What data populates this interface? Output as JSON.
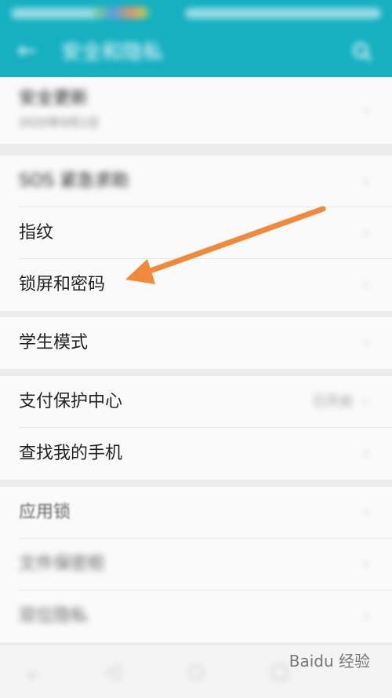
{
  "header": {
    "title": "安全和隐私"
  },
  "groups": [
    {
      "items": [
        {
          "label": "安全更新",
          "sub": "2020年9月1日"
        }
      ]
    },
    {
      "items": [
        {
          "label": "SOS 紧急求助"
        },
        {
          "label": "指纹"
        },
        {
          "label": "锁屏和密码"
        }
      ]
    },
    {
      "items": [
        {
          "label": "学生模式"
        }
      ]
    },
    {
      "items": [
        {
          "label": "支付保护中心",
          "value": "已开启"
        },
        {
          "label": "查找我的手机"
        }
      ]
    },
    {
      "items": [
        {
          "label": "应用锁"
        },
        {
          "label": "文件保密柜"
        },
        {
          "label": "双位隐私"
        }
      ]
    }
  ],
  "watermark": "Baidu 经验",
  "colors": {
    "app_bar": "#16b0c1",
    "arrow": "#f08a3a"
  }
}
